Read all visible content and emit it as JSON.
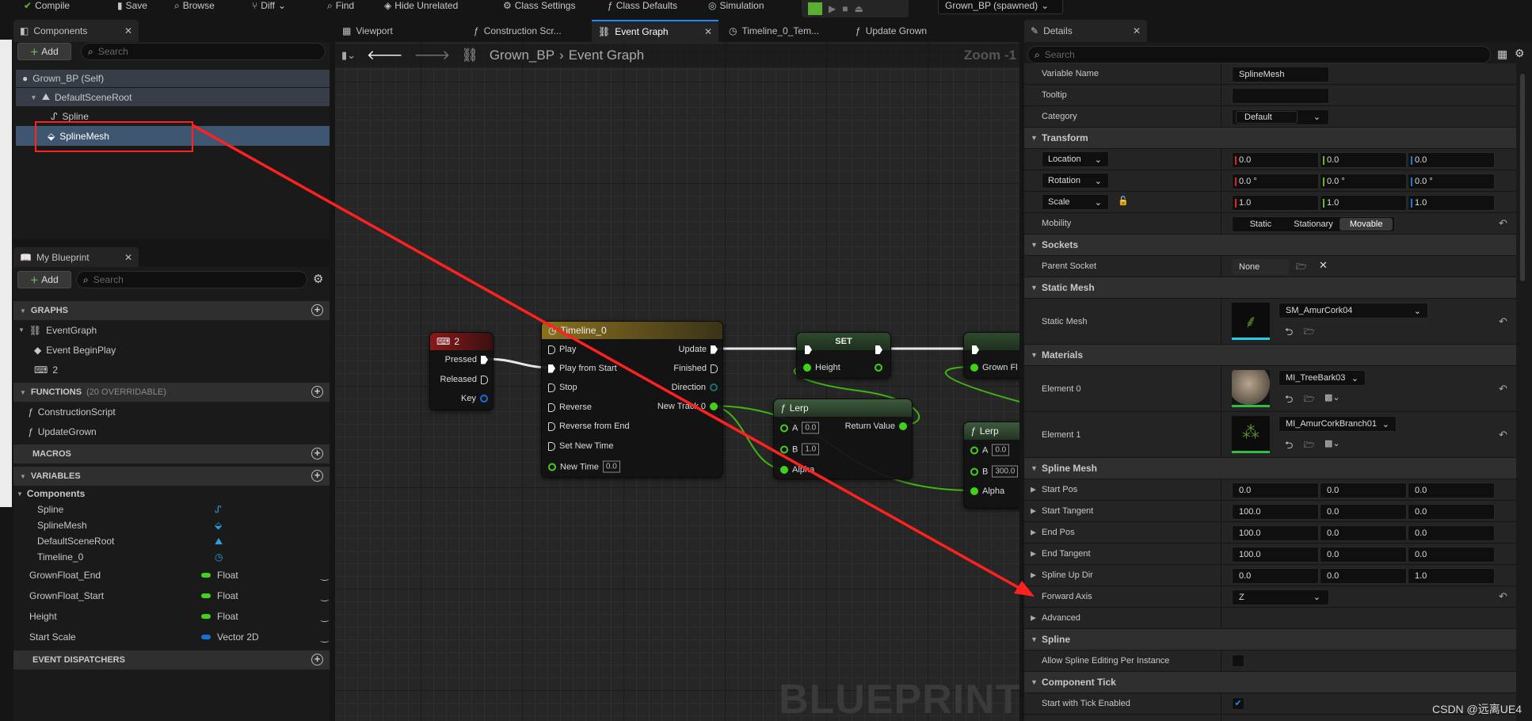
{
  "toolbar": {
    "items": [
      "Compile",
      "Save",
      "Browse",
      "Diff",
      "Find",
      "Hide Unrelated",
      "Class Settings",
      "Class Defaults",
      "Simulation"
    ],
    "debug_target": "Grown_BP (spawned)"
  },
  "components_panel": {
    "tab": "Components",
    "add_label": "Add",
    "search_placeholder": "Search",
    "tree": [
      {
        "label": "Grown_BP (Self)",
        "icon": "actor-icon"
      },
      {
        "label": "DefaultSceneRoot",
        "icon": "scene-root-icon"
      },
      {
        "label": "Spline",
        "icon": "spline-icon"
      },
      {
        "label": "SplineMesh",
        "icon": "spline-mesh-icon",
        "selected": true
      }
    ]
  },
  "my_blueprint": {
    "tab": "My Blueprint",
    "add_label": "Add",
    "search_placeholder": "Search",
    "graphs_header": "GRAPHS",
    "graphs": [
      "EventGraph",
      "Event BeginPlay",
      "2"
    ],
    "functions_header": "FUNCTIONS",
    "functions_note": "(20 OVERRIDABLE)",
    "functions": [
      "ConstructionScript",
      "UpdateGrown"
    ],
    "macros_header": "MACROS",
    "variables_header": "VARIABLES",
    "components_group": "Components",
    "component_vars": [
      "Spline",
      "SplineMesh",
      "DefaultSceneRoot",
      "Timeline_0"
    ],
    "variables": [
      {
        "name": "GrownFloat_End",
        "type": "Float",
        "color": "#43d01a"
      },
      {
        "name": "GrownFloat_Start",
        "type": "Float",
        "color": "#43d01a"
      },
      {
        "name": "Height",
        "type": "Float",
        "color": "#43d01a"
      },
      {
        "name": "Start Scale",
        "type": "Vector 2D",
        "color": "#1a6fd6"
      }
    ],
    "dispatchers_header": "EVENT DISPATCHERS"
  },
  "editor_tabs": [
    "Viewport",
    "Construction Scr...",
    "Event Graph",
    "Timeline_0_Tem...",
    "Update Grown"
  ],
  "graph": {
    "breadcrumb": [
      "Grown_BP",
      "Event Graph"
    ],
    "zoom": "Zoom -1",
    "watermark": "BLUEPRINT",
    "key_node": {
      "title": "2",
      "pressed": "Pressed",
      "released": "Released",
      "key": "Key"
    },
    "timeline_node": {
      "title": "Timeline_0",
      "inputs": [
        "Play",
        "Play from Start",
        "Stop",
        "Reverse",
        "Reverse from End",
        "Set New Time"
      ],
      "new_time_label": "New Time",
      "new_time_value": "0.0",
      "outputs": [
        "Update",
        "Finished",
        "Direction",
        "New Track 0"
      ]
    },
    "set_node": {
      "title": "SET",
      "pin": "Height"
    },
    "set_node_2": {
      "pin": "Grown Fl"
    },
    "lerp_1": {
      "title": "Lerp",
      "a": "A",
      "a_value": "0.0",
      "b": "B",
      "b_value": "1.0",
      "alpha": "Alpha",
      "ret": "Return Value"
    },
    "lerp_2": {
      "title": "Lerp",
      "a": "A",
      "a_value": "0.0",
      "b": "B",
      "b_value": "300.0",
      "alpha": "Alpha"
    }
  },
  "details": {
    "tab": "Details",
    "search_placeholder": "Search",
    "rows": [
      {
        "kind": "text",
        "label": "Variable Name",
        "value": "SplineMesh"
      },
      {
        "kind": "text",
        "label": "Tooltip",
        "value": ""
      },
      {
        "kind": "combo",
        "label": "Category",
        "value": "Default"
      },
      {
        "kind": "section",
        "label": "Transform"
      },
      {
        "kind": "vec3",
        "label": "Location",
        "label_dropdown": true,
        "colored": true,
        "values": [
          "0.0",
          "0.0",
          "0.0"
        ]
      },
      {
        "kind": "vec3",
        "label": "Rotation",
        "label_dropdown": true,
        "colored": true,
        "values": [
          "0.0 °",
          "0.0 °",
          "0.0 °"
        ]
      },
      {
        "kind": "vec3",
        "label": "Scale",
        "label_dropdown": true,
        "colored": true,
        "lock": true,
        "values": [
          "1.0",
          "1.0",
          "1.0"
        ]
      },
      {
        "kind": "segmented",
        "label": "Mobility",
        "options": [
          "Static",
          "Stationary",
          "Movable"
        ],
        "selected": "Movable",
        "reset": true
      },
      {
        "kind": "section",
        "label": "Sockets"
      },
      {
        "kind": "socket",
        "label": "Parent Socket",
        "value": "None"
      },
      {
        "kind": "section",
        "label": "Static Mesh"
      },
      {
        "kind": "asset",
        "label": "Static Mesh",
        "value": "SM_AmurCork04",
        "thumb": "tree",
        "reset": true
      },
      {
        "kind": "section",
        "label": "Materials"
      },
      {
        "kind": "asset",
        "label": "Element 0",
        "value": "MI_TreeBark03",
        "thumb": "bark",
        "material": true,
        "reset": true
      },
      {
        "kind": "asset",
        "label": "Element 1",
        "value": "MI_AmurCorkBranch01",
        "thumb": "branch",
        "material": true,
        "reset": true
      },
      {
        "kind": "section",
        "label": "Spline Mesh"
      },
      {
        "kind": "vec3",
        "label": "Start Pos",
        "expandable": true,
        "values": [
          "0.0",
          "0.0",
          "0.0"
        ]
      },
      {
        "kind": "vec3",
        "label": "Start Tangent",
        "expandable": true,
        "values": [
          "100.0",
          "0.0",
          "0.0"
        ]
      },
      {
        "kind": "vec3",
        "label": "End Pos",
        "expandable": true,
        "values": [
          "100.0",
          "0.0",
          "0.0"
        ]
      },
      {
        "kind": "vec3",
        "label": "End Tangent",
        "expandable": true,
        "values": [
          "100.0",
          "0.0",
          "0.0"
        ]
      },
      {
        "kind": "vec3",
        "label": "Spline Up Dir",
        "expandable": true,
        "values": [
          "0.0",
          "0.0",
          "1.0"
        ]
      },
      {
        "kind": "combo",
        "label": "Forward Axis",
        "value": "Z",
        "reset": true
      },
      {
        "kind": "group",
        "label": "Advanced",
        "expandable": true
      },
      {
        "kind": "section",
        "label": "Spline"
      },
      {
        "kind": "check",
        "label": "Allow Spline Editing Per Instance",
        "checked": false
      },
      {
        "kind": "section",
        "label": "Component Tick"
      },
      {
        "kind": "check",
        "label": "Start with Tick Enabled",
        "checked": true
      },
      {
        "kind": "text",
        "label": "",
        "value": ""
      }
    ]
  },
  "watermark": "CSDN @远离UE4",
  "colors": {
    "accent": "#1a8cff",
    "float_pin": "#43d01a",
    "vector2d_pin": "#1a6fd6",
    "selection": "#3f5670",
    "annotation": "#ff2020"
  }
}
